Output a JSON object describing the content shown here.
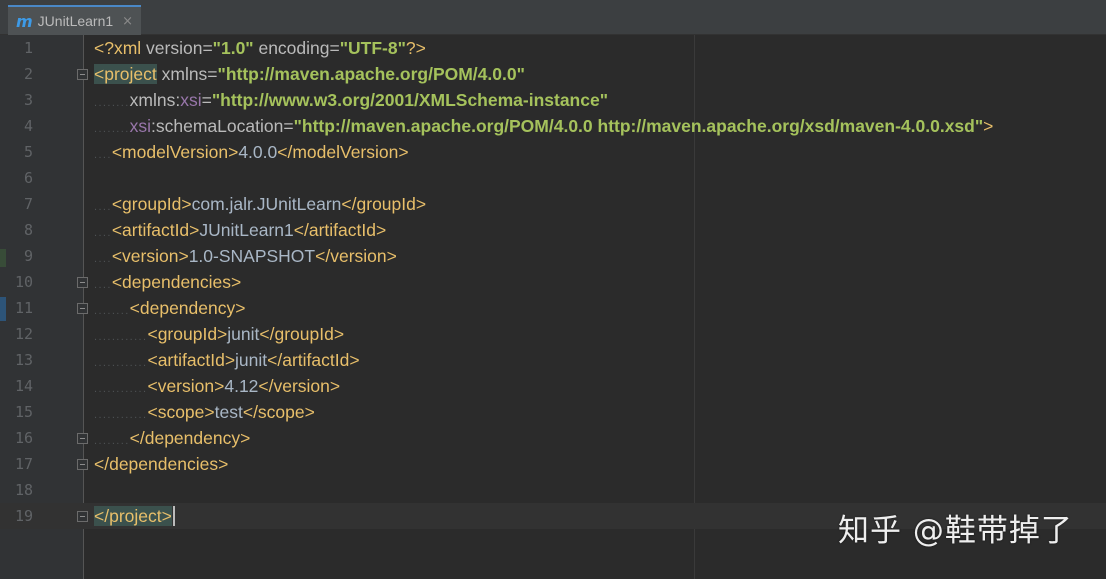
{
  "tab": {
    "icon": "maven-m-icon",
    "icon_glyph": "m",
    "title": "JUnitLearn1",
    "close_glyph": "×"
  },
  "editor": {
    "lines": [
      {
        "num": "1",
        "indent": "",
        "segments": [
          [
            "pi",
            "<?xml "
          ],
          [
            "a",
            "version="
          ],
          [
            "v",
            "\"1.0\""
          ],
          [
            "a",
            " encoding="
          ],
          [
            "v",
            "\"UTF-8\""
          ],
          [
            "pi",
            "?>"
          ]
        ]
      },
      {
        "num": "2",
        "indent": "",
        "segments": [
          [
            "hl t",
            "<project"
          ],
          [
            "a",
            " xmlns="
          ],
          [
            "v",
            "\"http://maven.apache.org/POM/4.0.0\""
          ]
        ]
      },
      {
        "num": "3",
        "indent": "........",
        "segments": [
          [
            "a",
            "xmlns:"
          ],
          [
            "ns",
            "xsi"
          ],
          [
            "a",
            "="
          ],
          [
            "v",
            "\"http://www.w3.org/2001/XMLSchema-instance\""
          ]
        ]
      },
      {
        "num": "4",
        "indent": "........",
        "segments": [
          [
            "ns",
            "xsi"
          ],
          [
            "a",
            ":schemaLocation="
          ],
          [
            "v",
            "\"http://maven.apache.org/POM/4.0.0 http://maven.apache.org/xsd/maven-4.0.0.xsd\""
          ],
          [
            "t",
            ">"
          ]
        ]
      },
      {
        "num": "5",
        "indent": "....",
        "segments": [
          [
            "t",
            "<modelVersion>"
          ],
          [
            "tx",
            "4.0.0"
          ],
          [
            "t",
            "</modelVersion>"
          ]
        ]
      },
      {
        "num": "6",
        "indent": "",
        "segments": []
      },
      {
        "num": "7",
        "indent": "....",
        "segments": [
          [
            "t",
            "<groupId>"
          ],
          [
            "tx",
            "com.jalr.JUnitLearn"
          ],
          [
            "t",
            "</groupId>"
          ]
        ]
      },
      {
        "num": "8",
        "indent": "....",
        "segments": [
          [
            "t",
            "<artifactId>"
          ],
          [
            "tx",
            "JUnitLearn1"
          ],
          [
            "t",
            "</artifactId>"
          ]
        ]
      },
      {
        "num": "9",
        "indent": "....",
        "segments": [
          [
            "t",
            "<version>"
          ],
          [
            "tx",
            "1.0-SNAPSHOT"
          ],
          [
            "t",
            "</version>"
          ]
        ]
      },
      {
        "num": "10",
        "indent": "....",
        "segments": [
          [
            "t",
            "<dependencies>"
          ]
        ]
      },
      {
        "num": "11",
        "indent": "........",
        "segments": [
          [
            "t",
            "<dependency>"
          ]
        ]
      },
      {
        "num": "12",
        "indent": "............",
        "segments": [
          [
            "t",
            "<groupId>"
          ],
          [
            "tx",
            "junit"
          ],
          [
            "t",
            "</groupId>"
          ]
        ]
      },
      {
        "num": "13",
        "indent": "............",
        "segments": [
          [
            "t",
            "<artifactId>"
          ],
          [
            "tx",
            "junit"
          ],
          [
            "t",
            "</artifactId>"
          ]
        ]
      },
      {
        "num": "14",
        "indent": "............",
        "segments": [
          [
            "t",
            "<version>"
          ],
          [
            "tx",
            "4.12"
          ],
          [
            "t",
            "</version>"
          ]
        ]
      },
      {
        "num": "15",
        "indent": "............",
        "segments": [
          [
            "t",
            "<scope>"
          ],
          [
            "tx",
            "test"
          ],
          [
            "t",
            "</scope>"
          ]
        ]
      },
      {
        "num": "16",
        "indent": "........",
        "segments": [
          [
            "t",
            "</dependency>"
          ]
        ]
      },
      {
        "num": "17",
        "indent": "",
        "segments": [
          [
            "t",
            "</dependencies>"
          ]
        ]
      },
      {
        "num": "18",
        "indent": "",
        "segments": []
      },
      {
        "num": "19",
        "indent": "",
        "segments": [
          [
            "hl t",
            "</project>"
          ]
        ],
        "current": true
      }
    ]
  },
  "watermark": "知乎 @鞋带掉了",
  "colors": {
    "background": "#2b2b2b",
    "gutter": "#313335",
    "tag": "#e8bf6a",
    "attr_value": "#a5c25c",
    "namespace": "#9876aa",
    "text": "#a9b7c6"
  }
}
